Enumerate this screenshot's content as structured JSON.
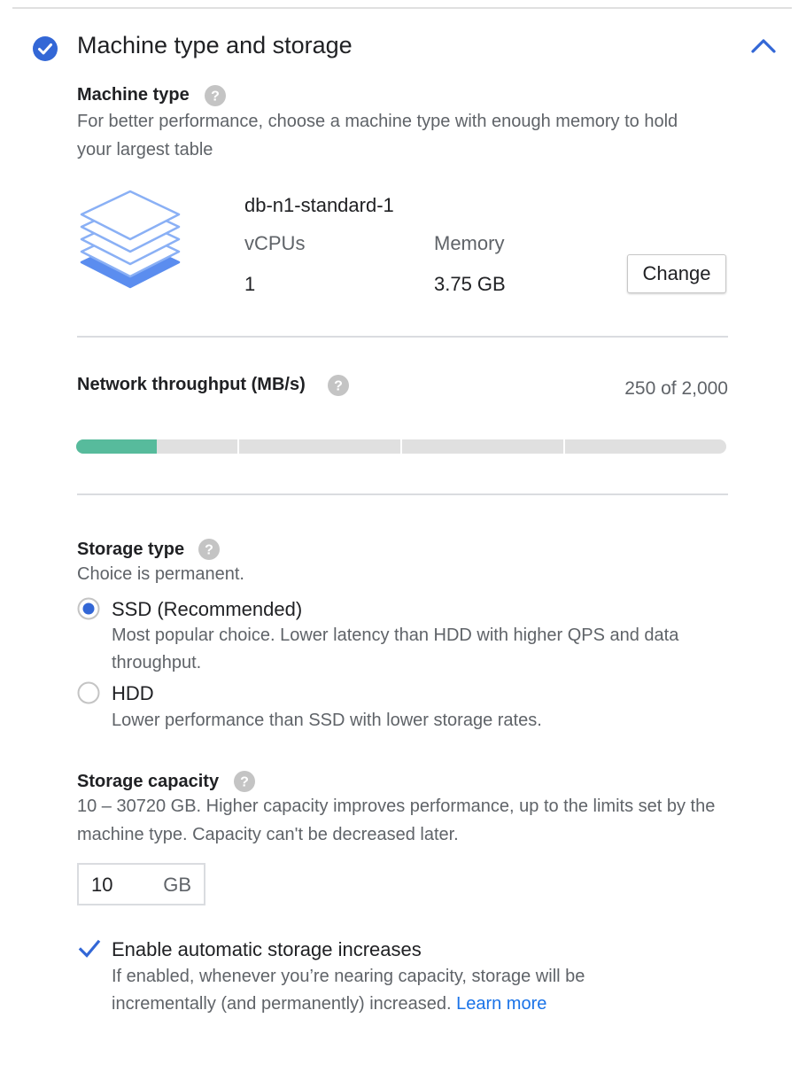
{
  "section": {
    "title": "Machine type and storage"
  },
  "icons": {
    "complete": "check-circle-icon",
    "collapse": "chevron-up-icon",
    "help": "help-icon",
    "machine": "layers-icon"
  },
  "colors": {
    "accent": "#3367d6",
    "progress_fill": "#57bb9c",
    "track": "#e0e0e0",
    "link": "#1a73e8"
  },
  "machine_type": {
    "label": "Machine type",
    "description": "For better performance, choose a machine type with enough memory to hold your largest table",
    "name": "db-n1-standard-1",
    "vcpus_label": "vCPUs",
    "vcpus_value": "1",
    "memory_label": "Memory",
    "memory_value": "3.75 GB",
    "change_label": "Change"
  },
  "network": {
    "label": "Network throughput (MB/s)",
    "value_text": "250 of 2,000",
    "current": 250,
    "max": 2000,
    "segments": 4
  },
  "storage_type": {
    "label": "Storage type",
    "note": "Choice is permanent.",
    "options": [
      {
        "label": "SSD (Recommended)",
        "description": "Most popular choice. Lower latency than HDD with higher QPS and data throughput.",
        "selected": true
      },
      {
        "label": "HDD",
        "description": "Lower performance than SSD with lower storage rates.",
        "selected": false
      }
    ]
  },
  "storage_capacity": {
    "label": "Storage capacity",
    "description": "10 – 30720 GB. Higher capacity improves performance, up to the limits set by the machine type. Capacity can't be decreased later.",
    "value": "10",
    "unit": "GB"
  },
  "auto_increase": {
    "checked": true,
    "label": "Enable automatic storage increases",
    "description": "If enabled, whenever you’re nearing capacity, storage will be incrementally (and permanently) increased.",
    "learn_more": "Learn more"
  }
}
